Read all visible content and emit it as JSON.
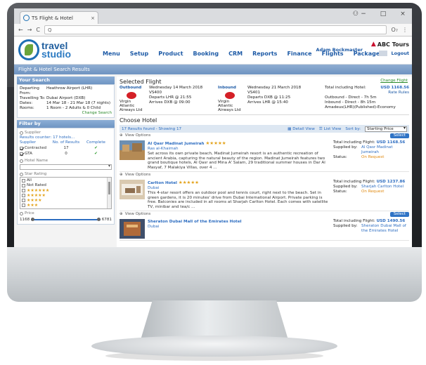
{
  "browser": {
    "tab_title": "TS Flight & Hotel",
    "tab_close": "×",
    "address": "Q",
    "nav_back": "←",
    "nav_forward": "→",
    "nav_reload": "C",
    "window_user": "⚇",
    "win_min": "−",
    "win_max": "□",
    "win_close": "×",
    "key_icon": "O₇",
    "menu_icon": "⋮"
  },
  "app": {
    "logo_line1": "travel",
    "logo_line2": "studio",
    "nav": [
      "Menu",
      "Setup",
      "Product",
      "Booking",
      "CRM",
      "Reports",
      "Finance",
      "Flights",
      "Package"
    ],
    "user_name": "Adam Bockmaster",
    "brand_name": "ABC Tours",
    "logout": "Logout",
    "page_title": "Flight & Hotel Search Results"
  },
  "search": {
    "heading": "Your Search",
    "rows": [
      {
        "k": "Departing From:",
        "v": "Heathrow Airport (LHR)"
      },
      {
        "k": "Travelling To:",
        "v": "Dubai Airport (DXB)"
      },
      {
        "k": "Dates:",
        "v": "14 Mar 18 - 21 Mar 18 (7 nights)"
      },
      {
        "k": "Rooms:",
        "v": "1 Room - 2 Adults & 0 Child"
      }
    ],
    "change": "Change Search"
  },
  "filter": {
    "heading": "Filter by",
    "supplier_label": "Supplier",
    "results_counter": "Results counter:  17 hotels...",
    "col_supplier": "Supplier",
    "col_results": "No. of Results",
    "col_complete": "Complete",
    "suppliers": [
      {
        "name": "Contracted",
        "count": "17",
        "check": "✔"
      },
      {
        "name": "GTA",
        "count": "0",
        "check": "✔"
      }
    ],
    "hotel_name_label": "Hotel Name",
    "star_label": "Star Rating",
    "star_rows": [
      {
        "label": "All",
        "stars": ""
      },
      {
        "label": "Not Rated",
        "stars": ""
      },
      {
        "label": "",
        "stars": "★★★★★★"
      },
      {
        "label": "",
        "stars": "★★★★★"
      },
      {
        "label": "",
        "stars": "★★★★"
      },
      {
        "label": "",
        "stars": "★★★"
      },
      {
        "label": "",
        "stars": "★★"
      }
    ],
    "price_label": "Price",
    "price_min": "1168",
    "price_max": "6781"
  },
  "flight": {
    "heading": "Selected Flight",
    "change": "Change Flight",
    "outbound": {
      "dir": "Outbound",
      "airline": "Virgin Atlantic Airways Ltd",
      "date": "Wednesday 14 March 2018",
      "code": "VS400",
      "departs": "Departs LHR @ 21:55",
      "arrives": "Arrives DXB @ 09:00"
    },
    "inbound": {
      "dir": "Inbound",
      "airline": "Virgin Atlantic Airways Ltd",
      "date": "Wednesday 21 March 2018",
      "code": "VS401",
      "departs": "Departs DXB @ 11:25",
      "arrives": "Arrives LHR @ 15:40"
    },
    "total_label": "Total including Hotel:",
    "total_value": "USD 1168.56",
    "rate_rules": "Rate Rules",
    "summary": [
      "Outbound - Direct - 7h 5m",
      "Inbound - Direct - 8h 15m",
      "Amadeus(LHR)(Published)-Economy"
    ]
  },
  "hotels": {
    "heading": "Choose Hotel",
    "found": "17 Results found - Showing 17",
    "detail_view": "Detail View",
    "list_view": "List View",
    "sort_label": "Sort by:",
    "sort_value": "Starting Price",
    "view_options": "View Options",
    "select": "Select",
    "total_label": "Total including Flight:",
    "supplied_label": "Supplied by:",
    "status_label": "Status:",
    "items": [
      {
        "name": "Al Qasr Madinat Jumeirah",
        "stars": "★★★★★",
        "area": "Ras al-Khaimah",
        "desc": "Set across its own private beach, Madinat Jumeirah resort is an authentic recreation of ancient Arabia, capturing the natural beauty of the region. Madinat Jumeirah features two grand boutique hotels, Al Qasr and Mina A' Salam, 29 traditional summer houses in Dar Al Masyaf, 7 Malakiya Villas, over 4 ...",
        "price": "USD 1168.56",
        "supplier": "Al Qasr Madinat Jumeirah",
        "status": "On Request"
      },
      {
        "name": "Carlton Hotel",
        "stars": "★★★★★",
        "area": "Dubai",
        "desc": "This 4-star resort offers an outdoor pool and tennis court, right next to the beach. Set in green gardens, it is 20 minutes' drive from Dubai International Airport. Private parking is free. Balconies are included in all rooms at Sharjah Carlton Hotel. Each comes with satellite TV, minibar and tea/c ...",
        "price": "USD 1237.86",
        "supplier": "Sharjah Carlton Hotel",
        "status": "On Request"
      },
      {
        "name": "Sheraton Dubai Mall of the Emirates Hotel",
        "stars": "",
        "area": "Dubai",
        "desc": "",
        "price": "USD 1490.56",
        "supplier": "Sheraton Dubai Mall of the Emirates Hotel",
        "status": ""
      }
    ]
  }
}
